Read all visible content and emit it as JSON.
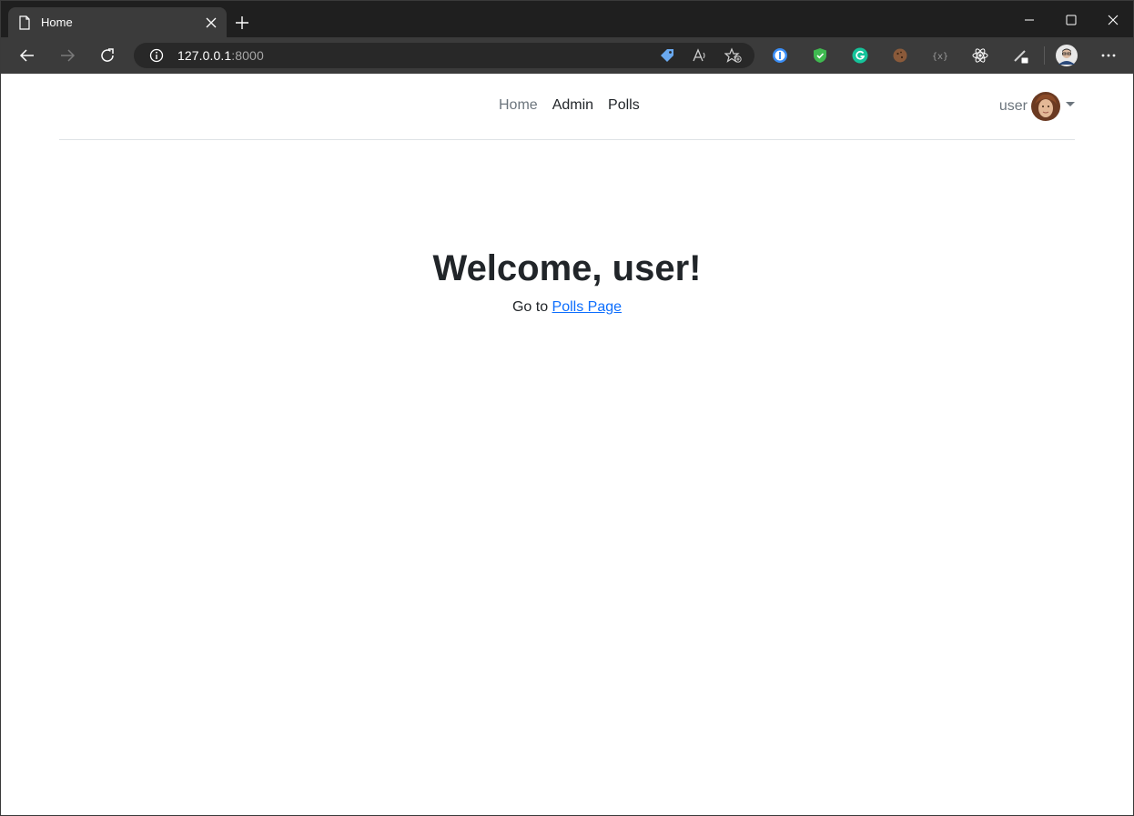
{
  "browser": {
    "tab_title": "Home",
    "url_host": "127.0.0.1",
    "url_port": ":8000",
    "icons": [
      "page-icon",
      "close-icon",
      "new-tab-icon",
      "minimize-icon",
      "maximize-icon",
      "close-window-icon",
      "back-icon",
      "forward-icon",
      "refresh-icon",
      "info-icon",
      "tag-icon",
      "read-aloud-icon",
      "favorites-icon",
      "password-manager-icon",
      "shield-icon",
      "grammarly-icon",
      "cookie-icon",
      "extension-icon",
      "react-icon",
      "pen-icon",
      "profile-icon",
      "more-icon"
    ]
  },
  "navbar": {
    "links": [
      {
        "label": "Home",
        "active": true
      },
      {
        "label": "Admin",
        "active": false
      },
      {
        "label": "Polls",
        "active": false
      }
    ],
    "user_label": "user"
  },
  "main": {
    "heading": "Welcome, user!",
    "subtext": "Go to ",
    "link_text": "Polls Page"
  },
  "colors": {
    "link": "#0d6efd",
    "text": "#212529",
    "muted": "#6c757d",
    "titlebar": "#1f1f1f",
    "toolbar": "#3b3b3b"
  }
}
